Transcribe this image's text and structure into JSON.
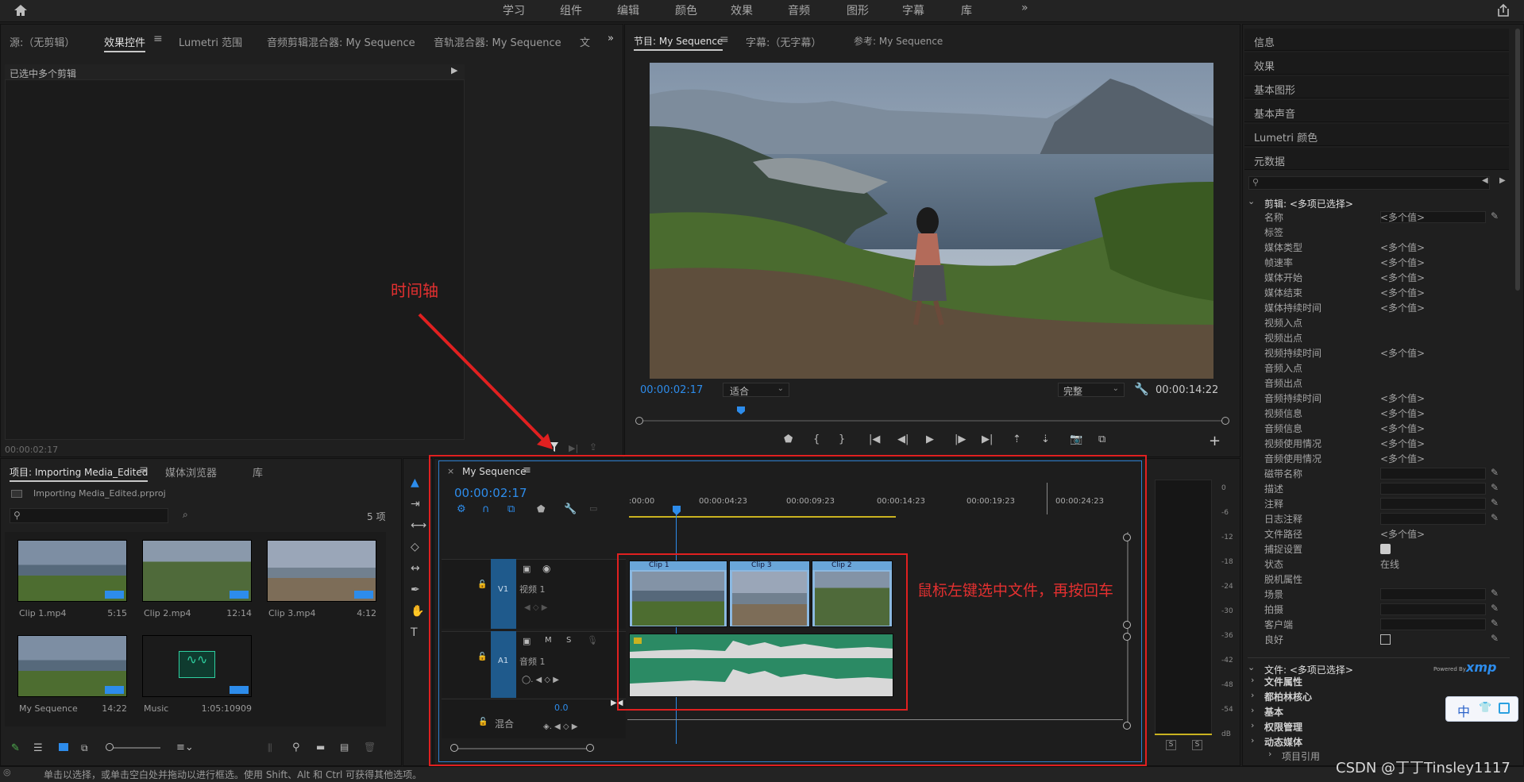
{
  "workspaces": [
    "学习",
    "组件",
    "编辑",
    "颜色",
    "效果",
    "音频",
    "图形",
    "字幕",
    "库"
  ],
  "top_tabs": {
    "source": "源:（无剪辑）",
    "effect_controls": "效果控件",
    "lumetri_scopes": "Lumetri 范围",
    "audio_clip_mixer": "音频剪辑混合器: My Sequence",
    "audio_track_mixer": "音轨混合器: My Sequence",
    "text": "文"
  },
  "effect_controls": {
    "header": "已选中多个剪辑",
    "timecode": "00:00:02:17"
  },
  "program": {
    "tab": "节目: My Sequence",
    "captions_tab": "字幕:（无字幕）",
    "reference_tab": "参考: My Sequence",
    "timecode": "00:00:02:17",
    "fit": "适合",
    "quality": "完整",
    "duration": "00:00:14:22"
  },
  "project": {
    "tab": "项目: Importing Media_Edited",
    "media_browser": "媒体浏览器",
    "library": "库",
    "filename": "Importing Media_Edited.prproj",
    "count": "5 项",
    "items": [
      {
        "name": "Clip 1.mp4",
        "dur": "5:15"
      },
      {
        "name": "Clip 2.mp4",
        "dur": "12:14"
      },
      {
        "name": "Clip 3.mp4",
        "dur": "4:12"
      },
      {
        "name": "My Sequence",
        "dur": "14:22"
      },
      {
        "name": "Music",
        "dur": "1:05:10909"
      }
    ]
  },
  "timeline": {
    "seq_name": "My Sequence",
    "timecode": "00:00:02:17",
    "ruler": [
      ":00:00",
      "00:00:04:23",
      "00:00:09:23",
      "00:00:14:23",
      "00:00:19:23",
      "00:00:24:23"
    ],
    "v1": "V1",
    "video1": "视频 1",
    "a1": "A1",
    "audio1": "音频 1",
    "mix": "混合",
    "mix_val": "0.0",
    "clips": [
      "Clip 1",
      "Clip 3",
      "Clip 2"
    ],
    "m": "M",
    "s": "S"
  },
  "meters": {
    "scale": [
      "0",
      "-6",
      "-12",
      "-18",
      "-24",
      "-30",
      "-36",
      "-42",
      "-48",
      "-54",
      "dB"
    ],
    "solo": [
      "S",
      "S"
    ]
  },
  "annotations": {
    "timeline_label": "时间轴",
    "instruction": "鼠标左键选中文件，再按回车"
  },
  "right_panel": {
    "items": [
      "信息",
      "效果",
      "基本图形",
      "基本声音",
      "Lumetri 颜色",
      "元数据"
    ],
    "clip_section": "剪辑: <多项已选择>",
    "rows": [
      {
        "l": "名称",
        "v": "<多个值>",
        "field": true,
        "pen": true
      },
      {
        "l": "标签",
        "v": ""
      },
      {
        "l": "媒体类型",
        "v": "<多个值>"
      },
      {
        "l": "帧速率",
        "v": "<多个值>"
      },
      {
        "l": "媒体开始",
        "v": "<多个值>"
      },
      {
        "l": "媒体结束",
        "v": "<多个值>"
      },
      {
        "l": "媒体持续时间",
        "v": "<多个值>"
      },
      {
        "l": "视频入点",
        "v": ""
      },
      {
        "l": "视频出点",
        "v": ""
      },
      {
        "l": "视频持续时间",
        "v": "<多个值>"
      },
      {
        "l": "音频入点",
        "v": ""
      },
      {
        "l": "音频出点",
        "v": ""
      },
      {
        "l": "音频持续时间",
        "v": "<多个值>"
      },
      {
        "l": "视频信息",
        "v": "<多个值>"
      },
      {
        "l": "音频信息",
        "v": "<多个值>"
      },
      {
        "l": "视频使用情况",
        "v": "<多个值>"
      },
      {
        "l": "音频使用情况",
        "v": "<多个值>"
      },
      {
        "l": "磁带名称",
        "v": "",
        "field": true,
        "pen": true
      },
      {
        "l": "描述",
        "v": "",
        "field": true,
        "pen": true
      },
      {
        "l": "注释",
        "v": "",
        "field": true,
        "pen": true
      },
      {
        "l": "日志注释",
        "v": "",
        "field": true,
        "pen": true
      },
      {
        "l": "文件路径",
        "v": "<多个值>"
      },
      {
        "l": "捕捉设置",
        "v": ""
      },
      {
        "l": "状态",
        "v": "在线"
      },
      {
        "l": "脱机属性",
        "v": ""
      },
      {
        "l": "场景",
        "v": "",
        "field": true,
        "pen": true
      },
      {
        "l": "拍摄",
        "v": "",
        "field": true,
        "pen": true
      },
      {
        "l": "客户端",
        "v": "",
        "field": true,
        "pen": true
      },
      {
        "l": "良好",
        "v": "",
        "pen": true
      }
    ],
    "file_section": "文件: <多项已选择>",
    "powered": "Powered By",
    "xmp": "xmp",
    "groups": [
      "文件属性",
      "都柏林核心",
      "基本",
      "权限管理",
      "动态媒体"
    ],
    "sub": "项目引用"
  },
  "status_bar": "单击以选择，或单击空白处并拖动以进行框选。使用 Shift、Alt 和 Ctrl 可获得其他选项。",
  "watermark": "CSDN @丁丁Tinsley1117",
  "ime": {
    "zh": "中"
  },
  "colors": {
    "accent": "#2d8ceb",
    "track": "#1f5a8c",
    "annotation": "#e43030"
  }
}
